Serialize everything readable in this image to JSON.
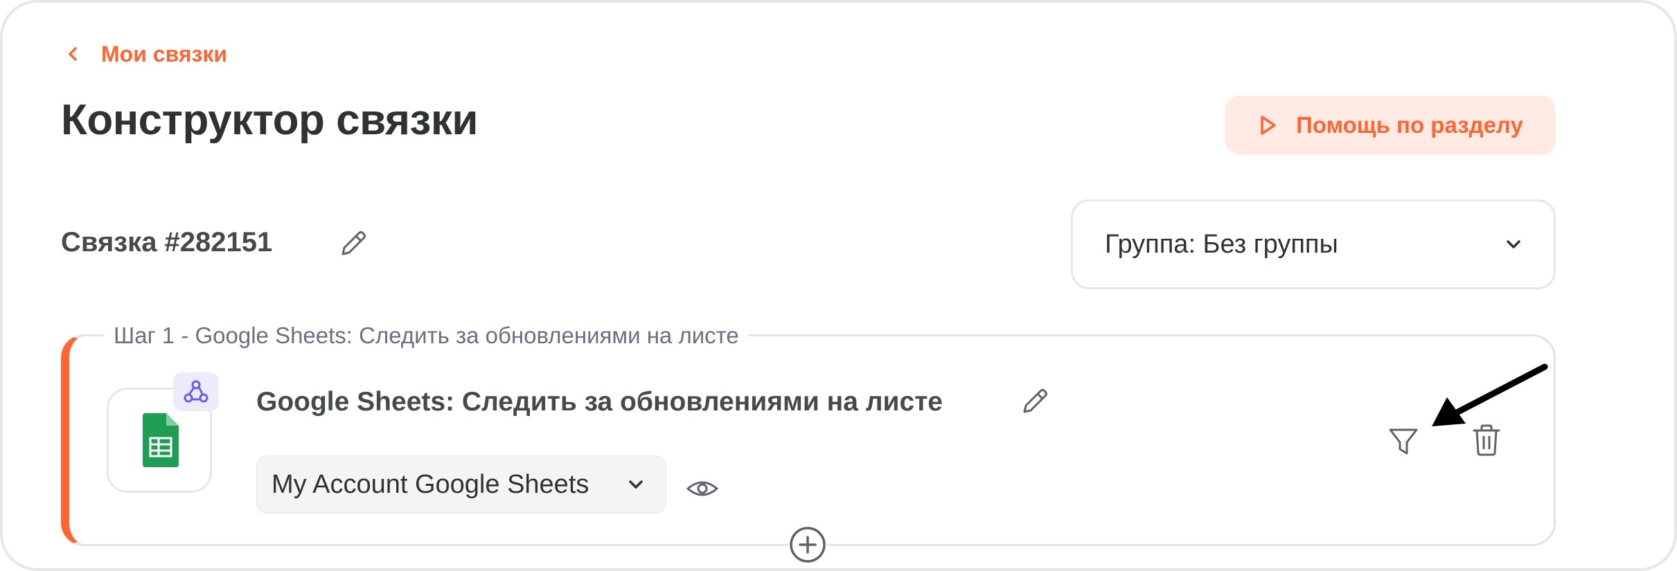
{
  "header": {
    "back_label": "Мои связки",
    "title": "Конструктор связки",
    "help_label": "Помощь по разделу"
  },
  "link": {
    "name": "Связка #282151",
    "group_select": "Группа: Без группы"
  },
  "step": {
    "legend": "Шаг 1 - Google Sheets: Следить за обновлениями на листе",
    "title": "Google Sheets: Следить за обновлениями на листе",
    "account_select": "My Account Google Sheets",
    "app_icon": "google-sheets-icon",
    "trigger_icon": "webhook-icon"
  },
  "icons": {
    "back": "chevron-left-icon",
    "help": "play-icon",
    "edit": "pencil-icon",
    "dropdown": "chevron-down-icon",
    "view": "eye-icon",
    "filter": "funnel-icon",
    "delete": "trash-icon",
    "add": "plus-circle-icon",
    "annotation": "arrow-annotation"
  },
  "colors": {
    "accent": "#ff6533",
    "accent_bg": "#ffebe3",
    "text": "#2e3330",
    "muted": "#6b7080",
    "sheets_green": "#1f9d55",
    "trigger_bg": "#ecebfb",
    "trigger_fg": "#6b5ce7"
  }
}
